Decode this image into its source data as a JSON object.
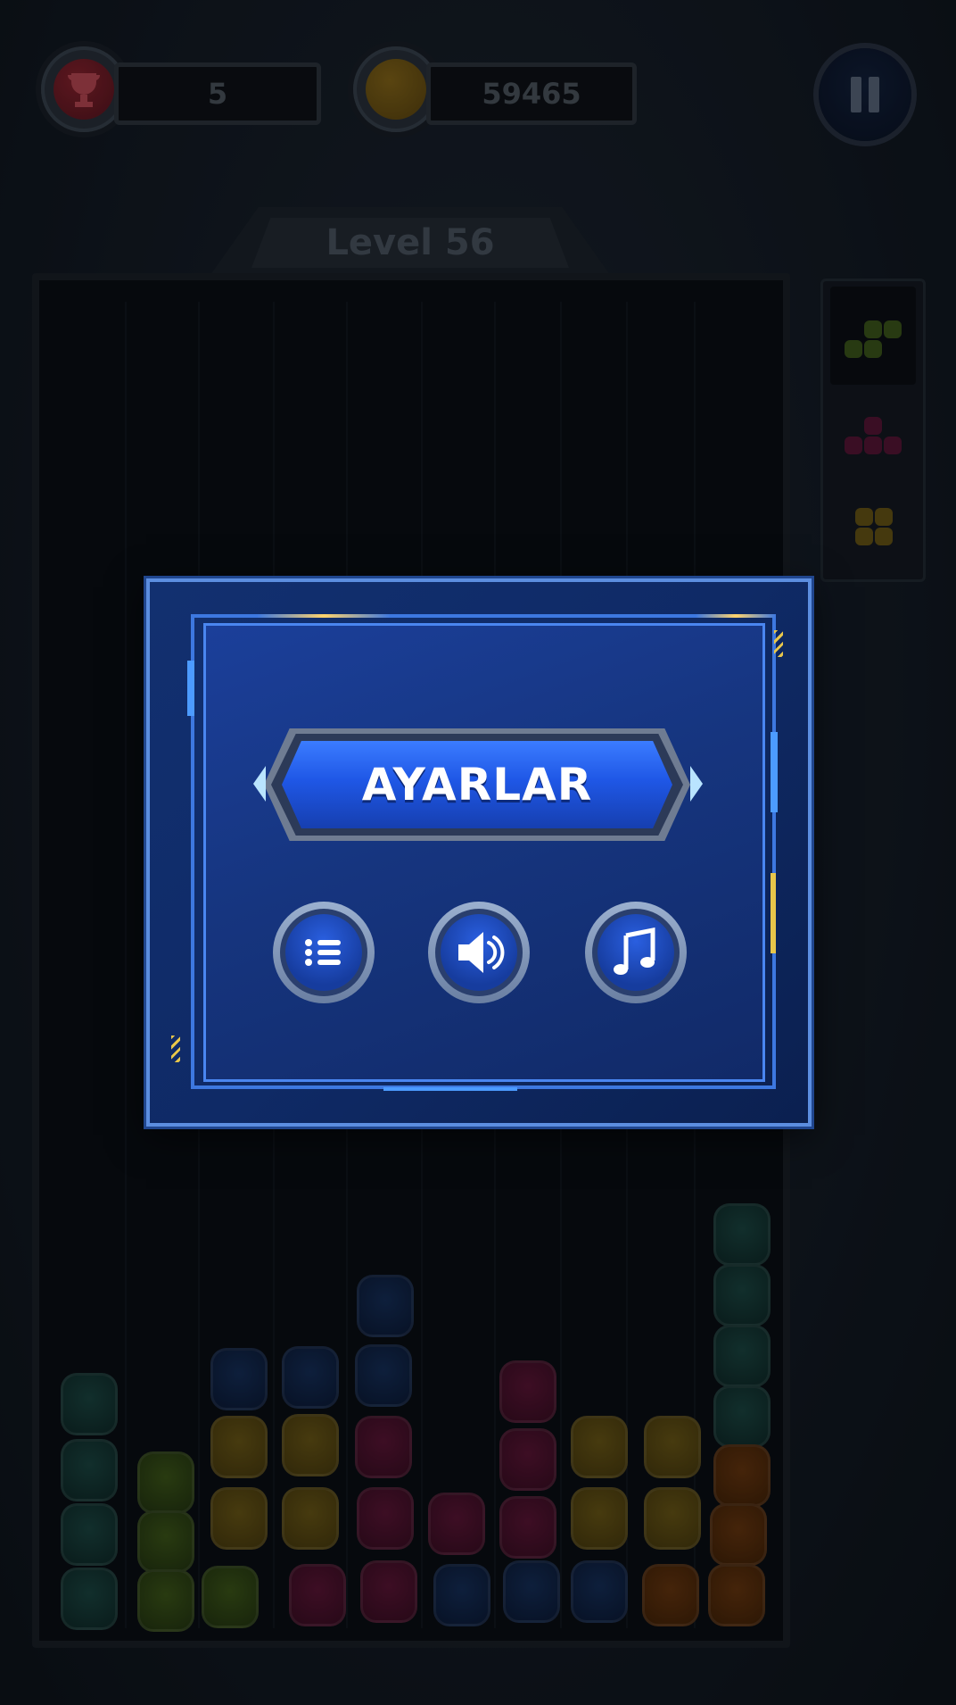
{
  "hud": {
    "trophy_count": "5",
    "coin_count": "59465"
  },
  "level": {
    "label": "Level 56"
  },
  "dialog": {
    "title": "AYARLAR",
    "buttons": [
      {
        "icon": "list-icon"
      },
      {
        "icon": "speaker-icon"
      },
      {
        "icon": "music-note-icon"
      }
    ]
  },
  "colors": {
    "dialog_bg": "#0f2a66",
    "title_blue": "#1f57e6",
    "board_bg": "#0a0f15"
  }
}
